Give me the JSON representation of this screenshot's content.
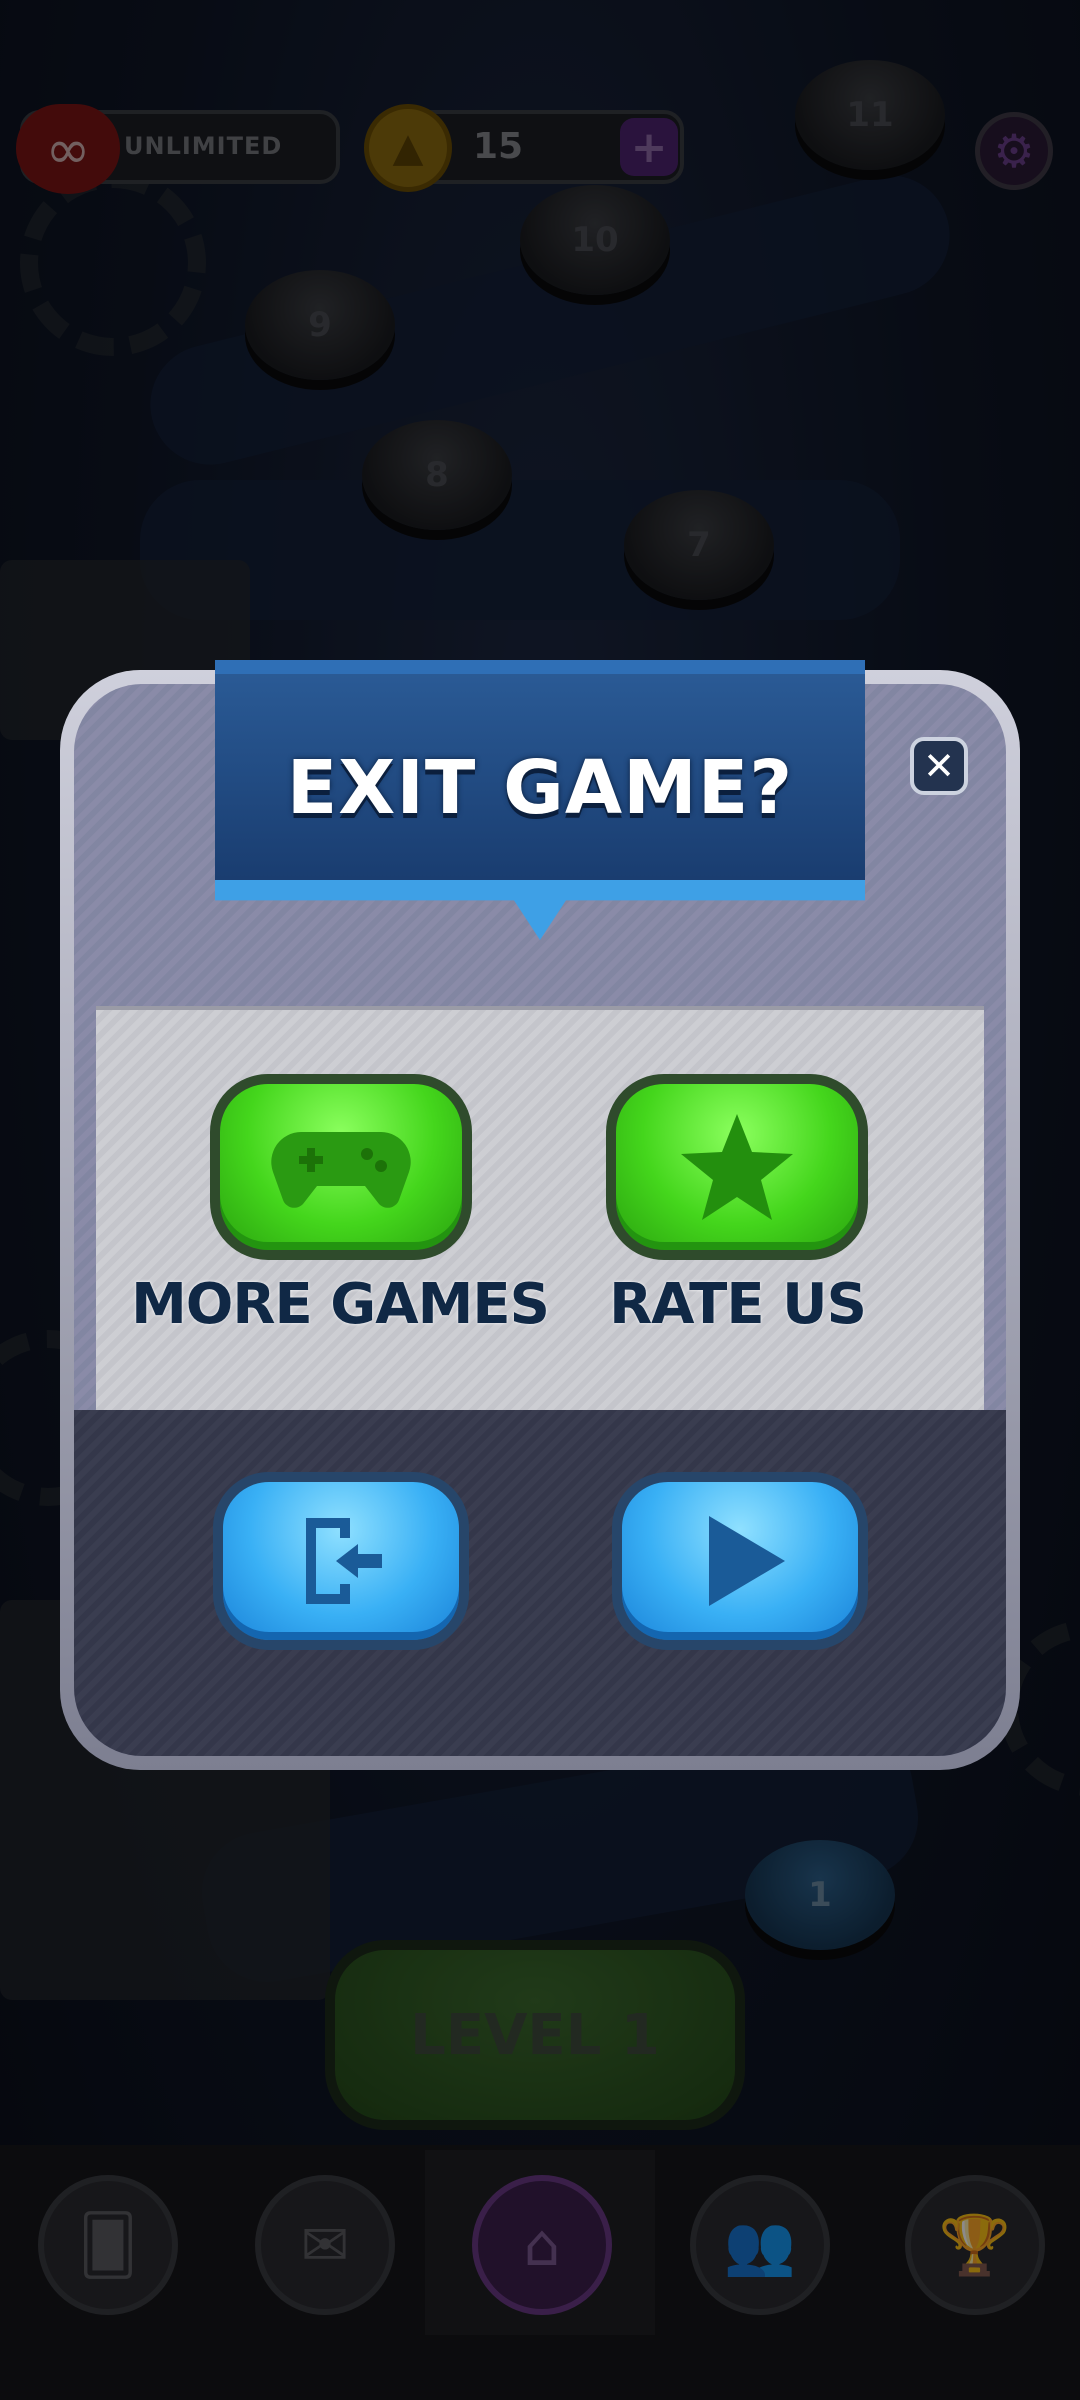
{
  "topbar": {
    "lives_icon": "infinity-heart-icon",
    "lives_label": "UNLIMITED",
    "coins_icon": "gold-coin-icon",
    "coins_value": "15",
    "add_coins_icon": "plus-icon",
    "settings_icon": "gear-icon"
  },
  "map": {
    "levels": [
      "11",
      "10",
      "9",
      "8",
      "7",
      "1"
    ]
  },
  "dialog": {
    "title": "EXIT GAME?",
    "close_icon": "close-icon",
    "more_games_label": "MORE GAMES",
    "more_games_icon": "gamepad-icon",
    "rate_us_label": "RATE US",
    "rate_us_icon": "star-icon",
    "exit_icon": "exit-door-icon",
    "continue_icon": "play-icon"
  },
  "level_button": "LEVEL 1",
  "navbar": {
    "items": [
      {
        "icon": "cards-icon"
      },
      {
        "icon": "mail-icon"
      },
      {
        "icon": "home-icon",
        "active": true
      },
      {
        "icon": "friends-icon"
      },
      {
        "icon": "trophy-icon"
      }
    ]
  },
  "colors": {
    "banner": "#1e4a86",
    "green_button": "#44d61c",
    "blue_button": "#39b0f5",
    "label_text": "#102845"
  }
}
